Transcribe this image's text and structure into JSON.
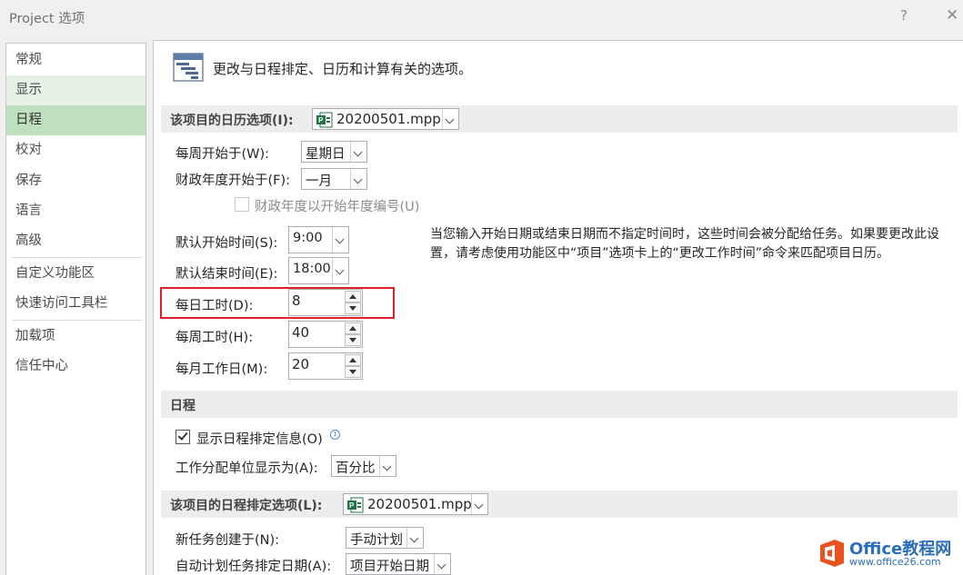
{
  "window": {
    "title": "Project 选项",
    "help_label": "?",
    "close_label": "✕"
  },
  "sidebar": {
    "items": [
      {
        "label": "常规"
      },
      {
        "label": "显示"
      },
      {
        "label": "日程"
      },
      {
        "label": "校对"
      },
      {
        "label": "保存"
      },
      {
        "label": "语言"
      },
      {
        "label": "高级"
      },
      {
        "label": "自定义功能区"
      },
      {
        "label": "快速访问工具栏"
      },
      {
        "label": "加载项"
      },
      {
        "label": "信任中心"
      }
    ],
    "active": "日程"
  },
  "main": {
    "header": "更改与日程排定、日历和计算有关的选项。",
    "calendar_section": {
      "title": "该项目的日历选项(I):",
      "project_file": "20200501.mpp",
      "week_starts_label": "每周开始于(W):",
      "week_starts_value": "星期日",
      "fiscal_year_label": "财政年度开始于(F):",
      "fiscal_year_value": "一月",
      "fiscal_numbering_label": "财政年度以开始年度编号(U)",
      "fiscal_numbering_checked": false,
      "default_start_label": "默认开始时间(S):",
      "default_start_value": "9:00",
      "default_end_label": "默认结束时间(E):",
      "default_end_value": "18:00",
      "hours_per_day_label": "每日工时(D):",
      "hours_per_day_value": "8",
      "hours_per_week_label": "每周工时(H):",
      "hours_per_week_value": "40",
      "days_per_month_label": "每月工作日(M):",
      "days_per_month_value": "20",
      "note": "当您输入开始日期或结束日期而不指定时间时，这些时间会被分配给任务。如果要更改此设置，请考虑使用功能区中“项目”选项卡上的“更改工作时间”命令来匹配项目日历。"
    },
    "schedule_section": {
      "title": "日程",
      "show_schedule_label": "显示日程排定信息(O)",
      "show_schedule_checked": true,
      "assignment_units_label": "工作分配单位显示为(A):",
      "assignment_units_value": "百分比"
    },
    "scheduling_options_section": {
      "title": "该项目的日程排定选项(L):",
      "project_file": "20200501.mpp",
      "new_tasks_label": "新任务创建于(N):",
      "new_tasks_value": "手动计划",
      "auto_tasks_label": "自动计划任务排定日期(A):",
      "auto_tasks_value": "项目开始日期"
    }
  },
  "watermark": {
    "brand": "Office教程网",
    "url": "www.office26.com"
  },
  "colors": {
    "accent_green": "#bfe0bf",
    "hover_green": "#e6f2e6",
    "highlight_red": "#e0202c",
    "file_icon_green": "#217346"
  }
}
